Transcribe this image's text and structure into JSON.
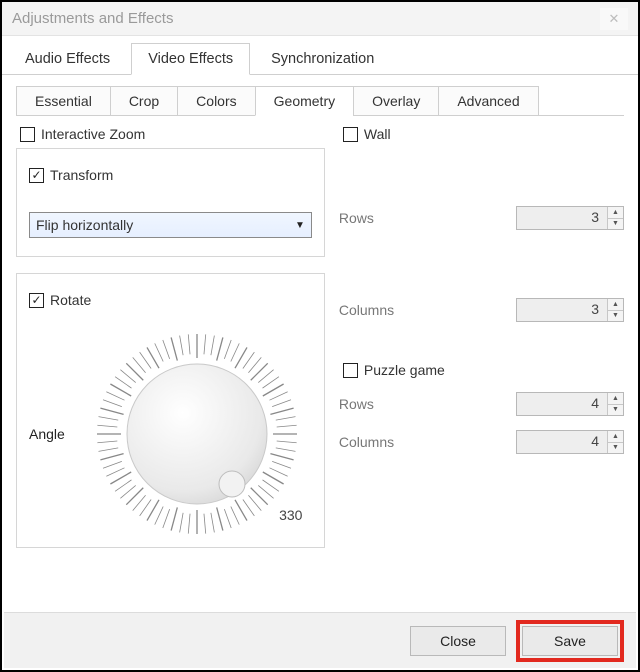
{
  "window": {
    "title": "Adjustments and Effects"
  },
  "tabs": {
    "audio": "Audio Effects",
    "video": "Video Effects",
    "sync": "Synchronization"
  },
  "subtabs": {
    "essential": "Essential",
    "crop": "Crop",
    "colors": "Colors",
    "geometry": "Geometry",
    "overlay": "Overlay",
    "advanced": "Advanced"
  },
  "left": {
    "interactive_zoom": "Interactive Zoom",
    "transform": "Transform",
    "transform_value": "Flip horizontally",
    "rotate": "Rotate",
    "angle_label": "Angle",
    "angle_value": "330"
  },
  "right": {
    "wall": {
      "title": "Wall",
      "rows_label": "Rows",
      "rows_value": "3",
      "cols_label": "Columns",
      "cols_value": "3"
    },
    "puzzle": {
      "title": "Puzzle game",
      "rows_label": "Rows",
      "rows_value": "4",
      "cols_label": "Columns",
      "cols_value": "4"
    }
  },
  "footer": {
    "close": "Close",
    "save": "Save"
  }
}
